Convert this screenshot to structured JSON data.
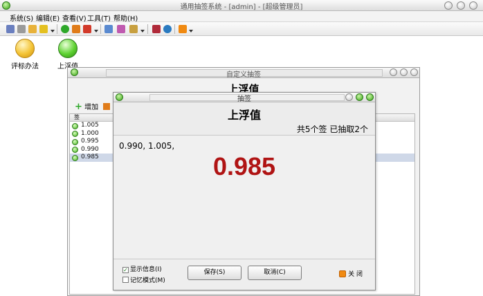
{
  "window": {
    "title": "通用抽签系统 - [admin] - [超级管理员]"
  },
  "menu": [
    {
      "label": "系统(S)"
    },
    {
      "label": "编辑(E)"
    },
    {
      "label": "查看(V)"
    },
    {
      "label": "工具(T)"
    },
    {
      "label": "帮助(H)"
    }
  ],
  "desktop": {
    "icons": [
      {
        "label": "评标办法",
        "color": "#f4c436"
      },
      {
        "label": "上浮值",
        "color": "#5ed232"
      }
    ]
  },
  "custom_window": {
    "title": "自定义抽签",
    "heading": "上浮值",
    "add_label": "增加",
    "list_header": "签",
    "items": [
      "1.005",
      "1.000",
      "0.995",
      "0.990",
      "0.985"
    ],
    "selected_index": 4
  },
  "draw_window": {
    "title": "抽签",
    "heading": "上浮值",
    "status": "共5个签 已抽取2个",
    "drawn_text": "0.990, 1.005,",
    "current_value": "0.985",
    "show_info": {
      "label": "显示信息(I)",
      "checked": true
    },
    "memory_mode": {
      "label": "记忆模式(M)",
      "checked": false
    },
    "save_label": "保存(S)",
    "cancel_label": "取消(C)",
    "close_label": "关 闭"
  }
}
